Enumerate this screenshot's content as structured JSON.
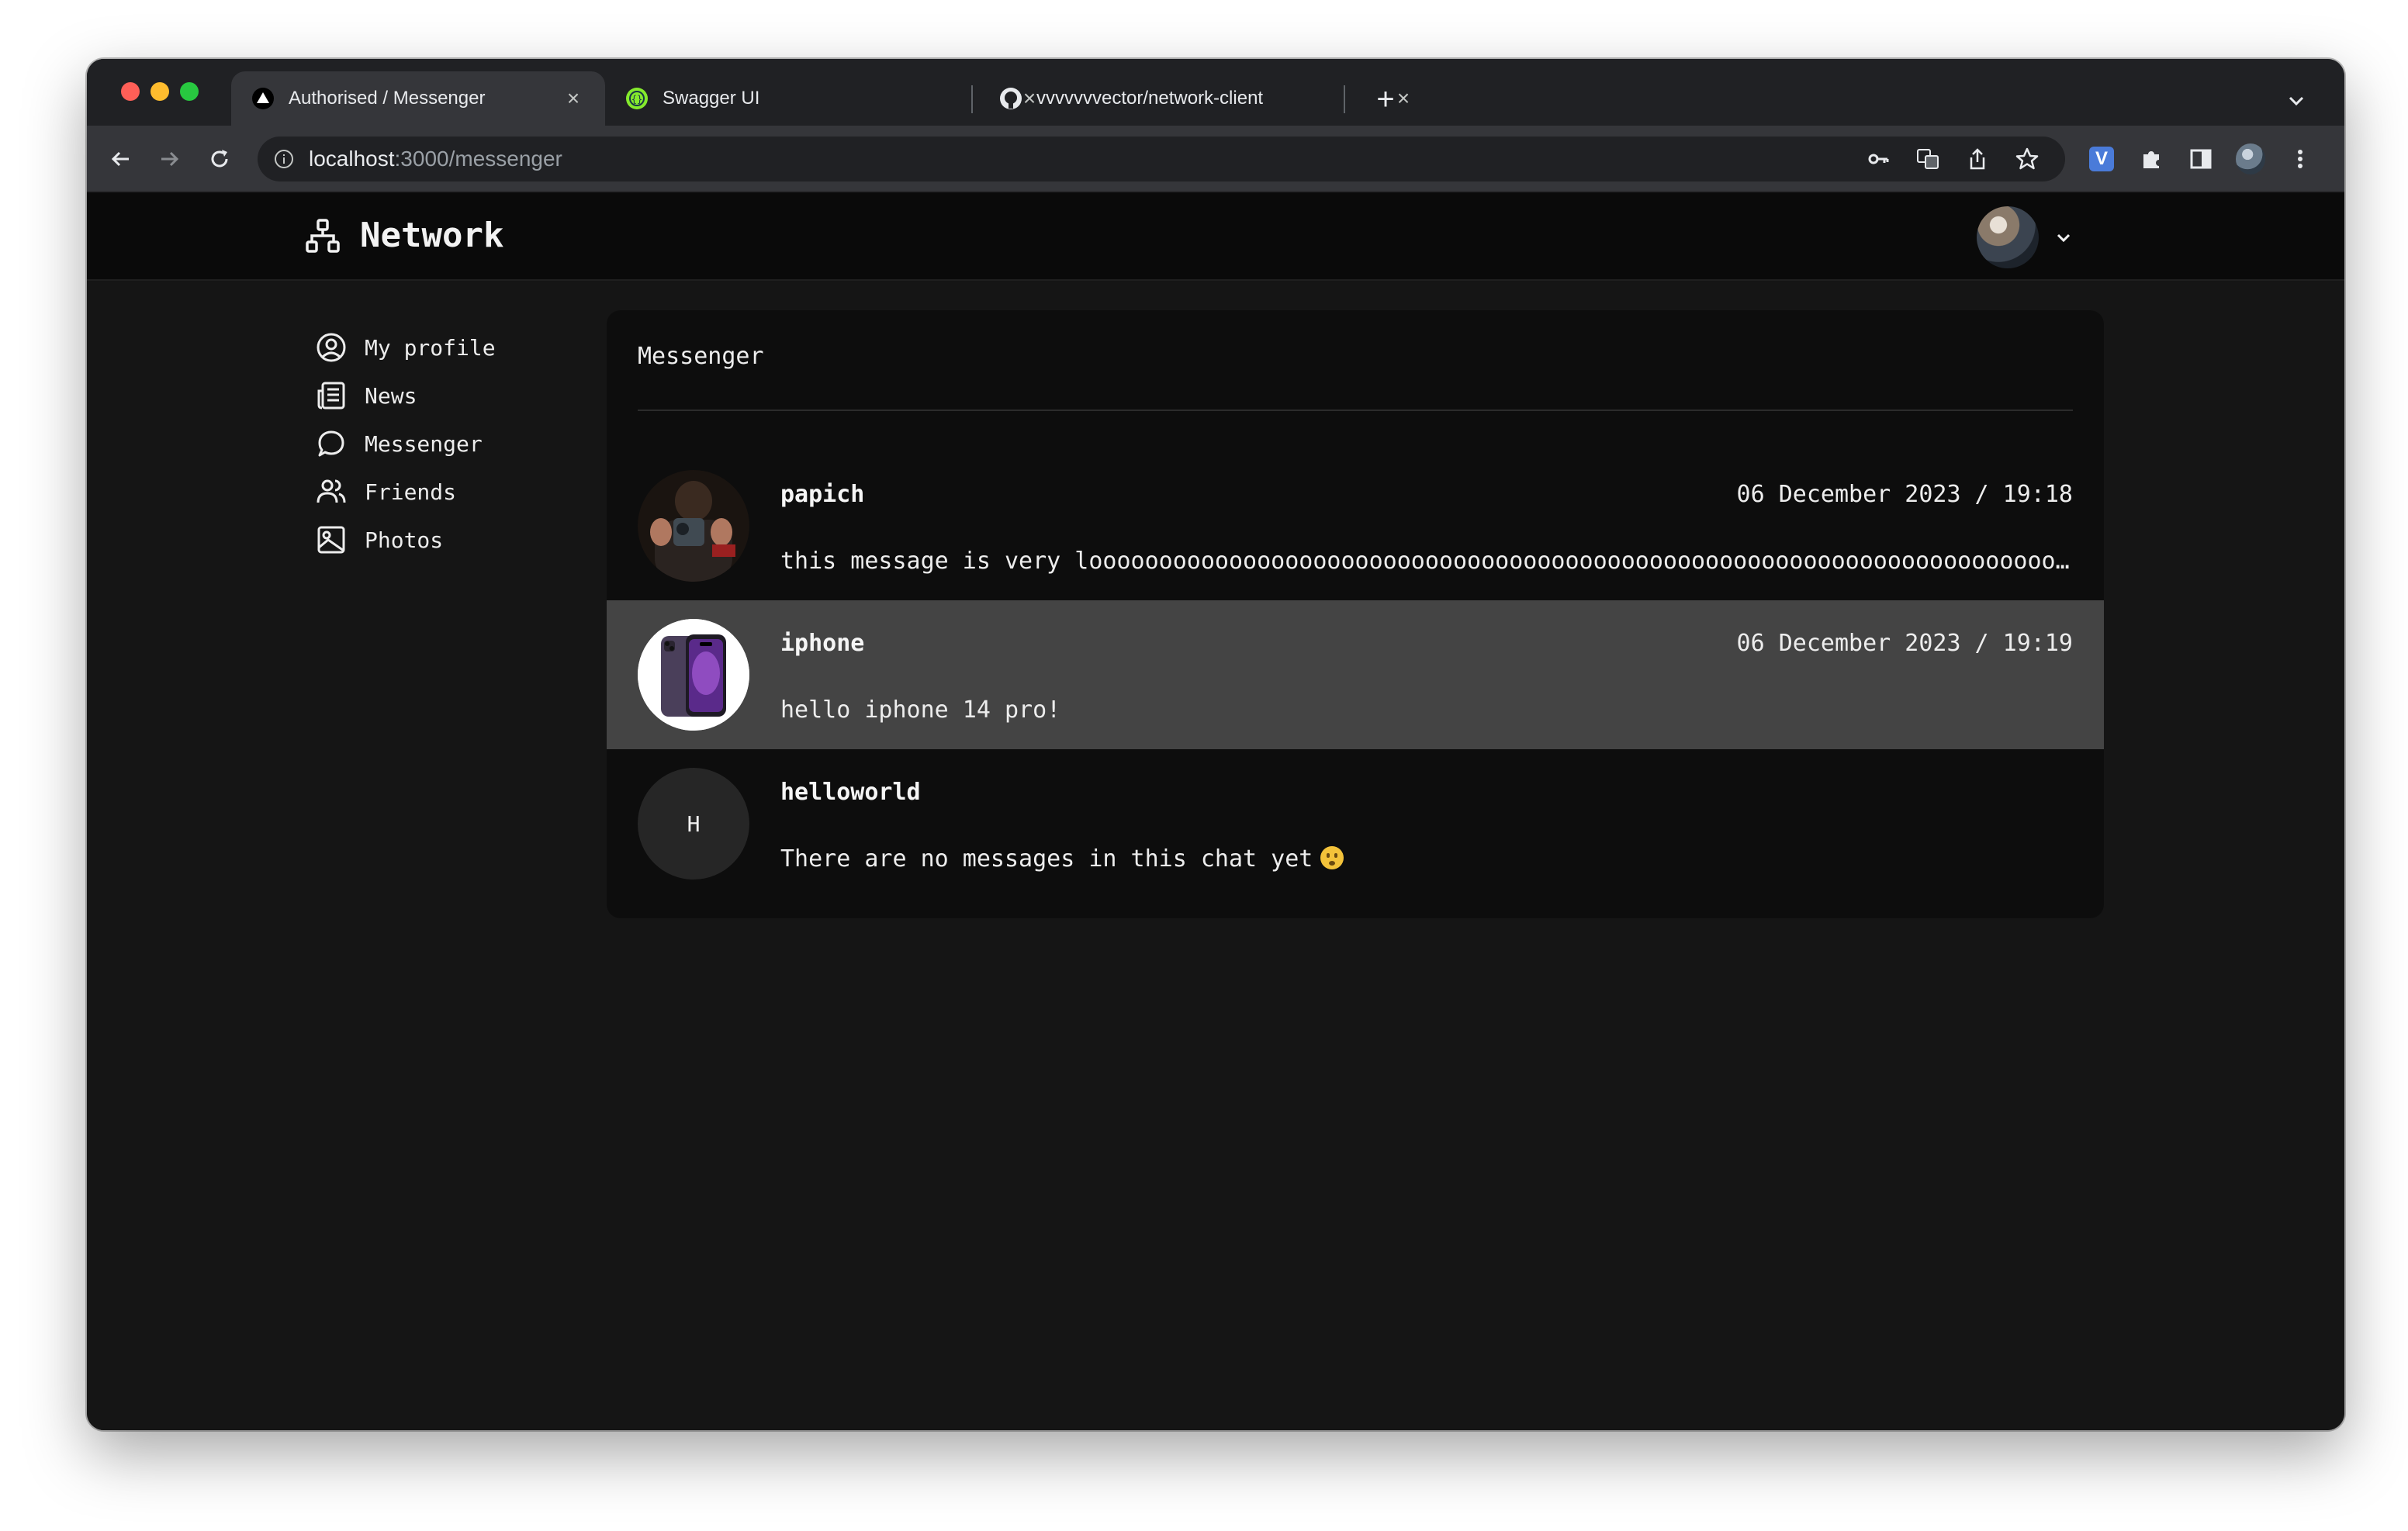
{
  "browser": {
    "tabs": [
      {
        "title": "Authorised / Messenger",
        "icon": "nextjs-icon",
        "active": true
      },
      {
        "title": "Swagger UI",
        "icon": "swagger-icon",
        "active": false
      },
      {
        "title": "vvvvvvvector/network-client",
        "icon": "github-icon",
        "active": false
      }
    ],
    "url": {
      "host": "localhost",
      "path": ":3000/messenger"
    }
  },
  "app": {
    "brand": "Network",
    "sidebar": {
      "items": [
        {
          "label": "My profile",
          "icon": "user-circle-icon"
        },
        {
          "label": "News",
          "icon": "newspaper-icon"
        },
        {
          "label": "Messenger",
          "icon": "chat-bubble-icon"
        },
        {
          "label": "Friends",
          "icon": "users-icon"
        },
        {
          "label": "Photos",
          "icon": "image-icon"
        }
      ]
    },
    "messenger": {
      "title": "Messenger",
      "chats": [
        {
          "name": "papich",
          "time": "06 December 2023 / 19:18",
          "message": "this message is very loooooooooooooooooooooooooooooooooooooooooooooooooooooooooooooooooooooooooooooooooooooooooooong",
          "selected": false
        },
        {
          "name": "iphone",
          "time": "06 December 2023 / 19:19",
          "message": "hello iphone 14 pro!",
          "selected": true
        },
        {
          "name": "helloworld",
          "time": "",
          "message": "There are no messages in this chat yet",
          "initial": "H",
          "selected": false
        }
      ]
    }
  },
  "colors": {
    "background": "#151515",
    "header": "#0a0a0a",
    "panel": "#0d0d0d",
    "selected_row": "#444444"
  }
}
